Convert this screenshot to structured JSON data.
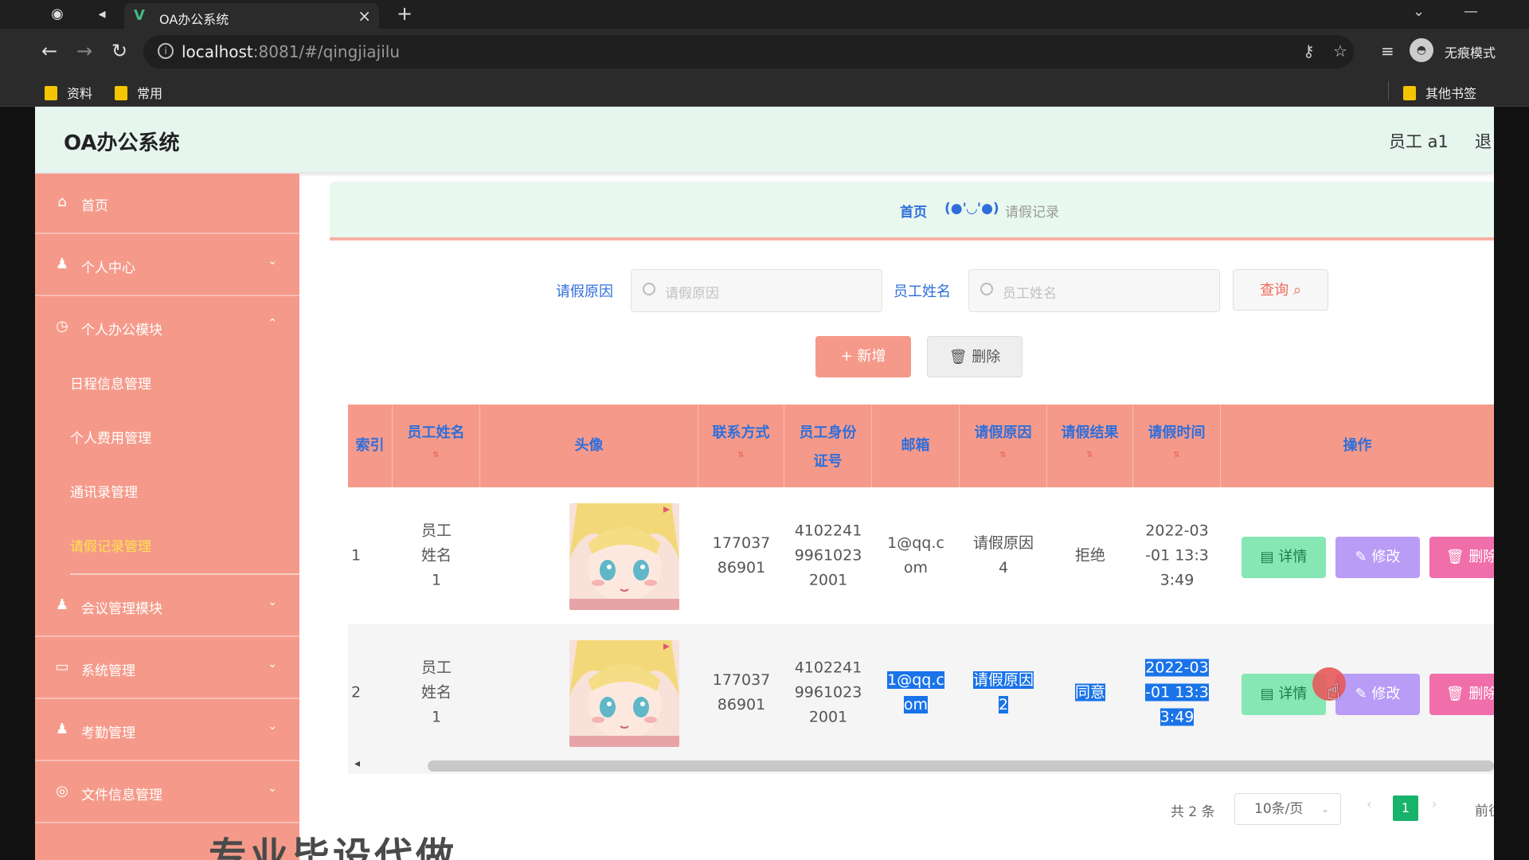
{
  "browser": {
    "tab_title": "OA办公系统",
    "url_host": "localhost",
    "url_path": ":8081/#/qingjiajilu",
    "profile_label": "无痕模式",
    "bookmarks": [
      "资料",
      "常用"
    ],
    "other_bookmarks": "其他书签"
  },
  "header": {
    "brand": "OA办公系统",
    "user": "员工 a1",
    "logout": "退"
  },
  "sidebar": {
    "items": [
      {
        "label": "首页",
        "icon": "home-icon"
      },
      {
        "label": "个人中心",
        "icon": "user-icon"
      },
      {
        "label": "个人办公模块",
        "icon": "clock-icon"
      },
      {
        "label": "会议管理模块",
        "icon": "user-icon"
      },
      {
        "label": "系统管理",
        "icon": "monitor-icon"
      },
      {
        "label": "考勤管理",
        "icon": "user-icon"
      },
      {
        "label": "文件信息管理",
        "icon": "globe-icon"
      }
    ],
    "sub_items": [
      "日程信息管理",
      "个人费用管理",
      "通讯录管理",
      "请假记录管理"
    ]
  },
  "breadcrumb": {
    "home": "首页",
    "face": "(●'◡'●)",
    "current": "请假记录"
  },
  "search": {
    "reason_label": "请假原因",
    "reason_placeholder": "请假原因",
    "name_label": "员工姓名",
    "name_placeholder": "员工姓名",
    "query_button": "查询"
  },
  "actions": {
    "add": "+ 新增",
    "delete": "删除"
  },
  "table": {
    "headers": [
      "索引",
      "员工姓名",
      "头像",
      "联系方式",
      "员工身份证号",
      "邮箱",
      "请假原因",
      "请假结果",
      "请假时间",
      "操作"
    ],
    "rows": [
      {
        "index": "1",
        "name": "员工姓名1",
        "phone": "17703786901",
        "idcard": "410224199610232001",
        "email": "1@qq.com",
        "reason": "请假原因4",
        "result": "拒绝",
        "time": "2022-03-01 13:33:49"
      },
      {
        "index": "2",
        "name": "员工姓名1",
        "phone": "17703786901",
        "idcard": "410224199610232001",
        "email": "1@qq.com",
        "reason": "请假原因2",
        "result": "同意",
        "time": "2022-03-01 13:33:49"
      }
    ],
    "op_detail": "详情",
    "op_edit": "修改",
    "op_delete": "删除"
  },
  "pager": {
    "total": "共 2 条",
    "page_size": "10条/页",
    "current_page": "1",
    "goto": "前往"
  },
  "overlay_text": "专业毕设代做"
}
